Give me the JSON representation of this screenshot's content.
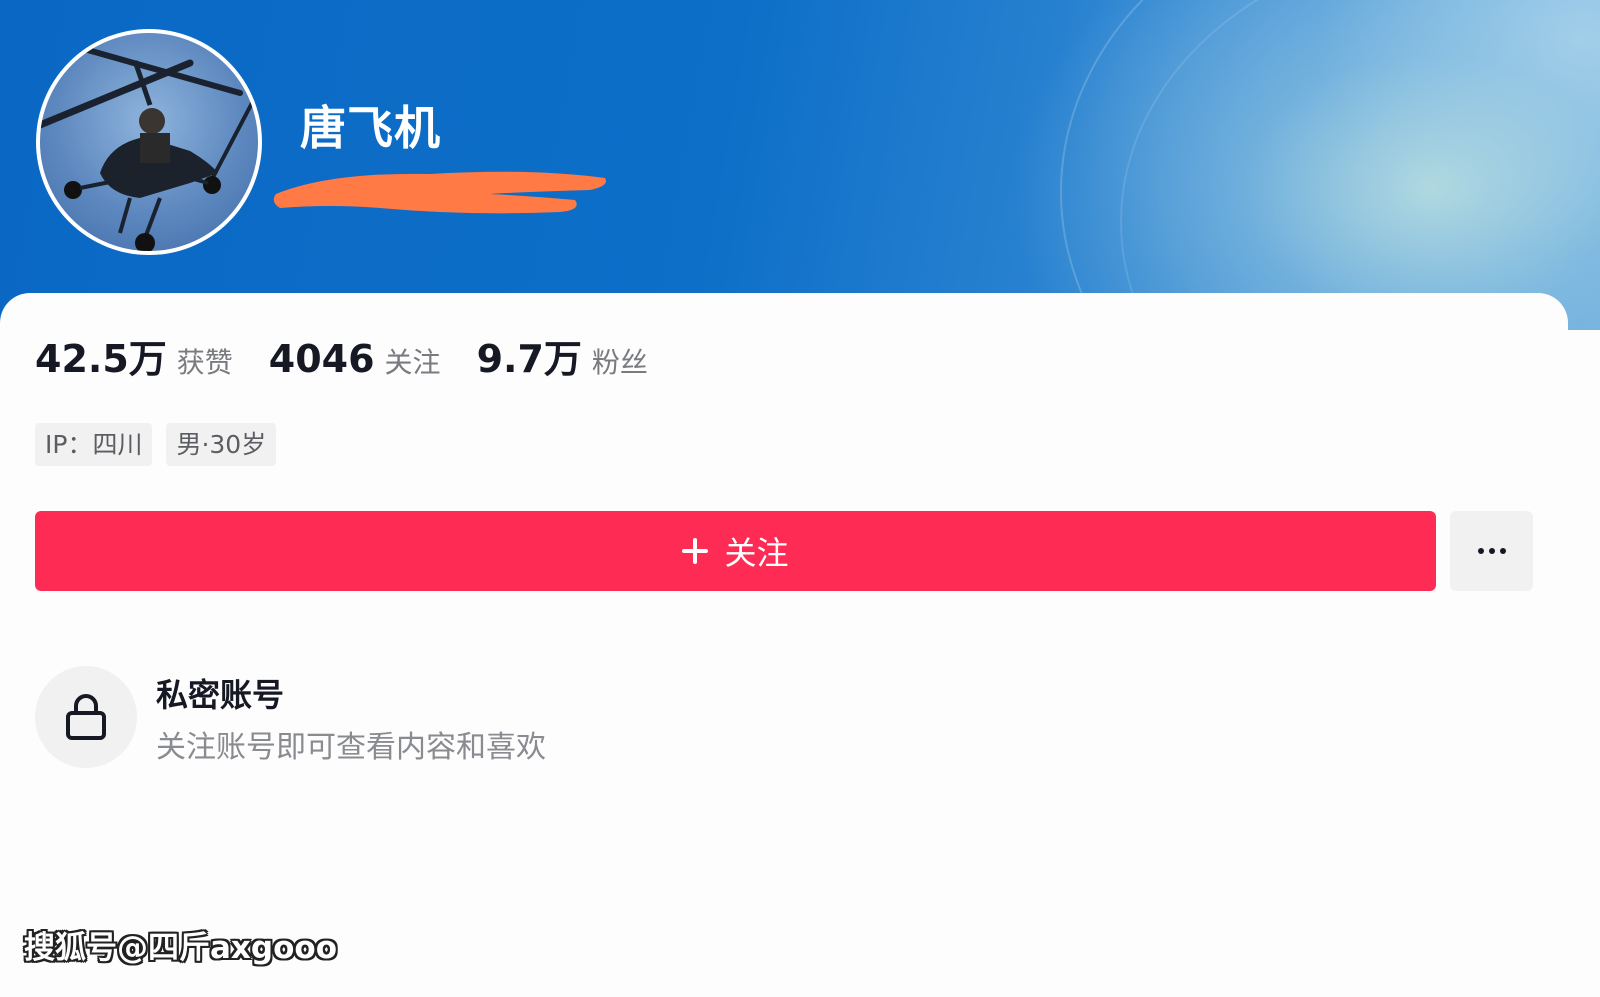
{
  "header": {
    "username": "唐飞机"
  },
  "stats": [
    {
      "value": "42.5万",
      "label": "获赞"
    },
    {
      "value": "4046",
      "label": "关注"
    },
    {
      "value": "9.7万",
      "label": "粉丝"
    }
  ],
  "tags": [
    "IP：四川",
    "男·30岁"
  ],
  "actions": {
    "follow_label": "关注",
    "more_icon": "more-dots-icon"
  },
  "private": {
    "title": "私密账号",
    "description": "关注账号即可查看内容和喜欢",
    "icon": "lock-icon"
  },
  "watermark": "搜狐号@四斤axgooo",
  "colors": {
    "accent": "#fe2c55",
    "header_blue": "#0a68c4",
    "tag_bg": "#f1f1f2"
  }
}
